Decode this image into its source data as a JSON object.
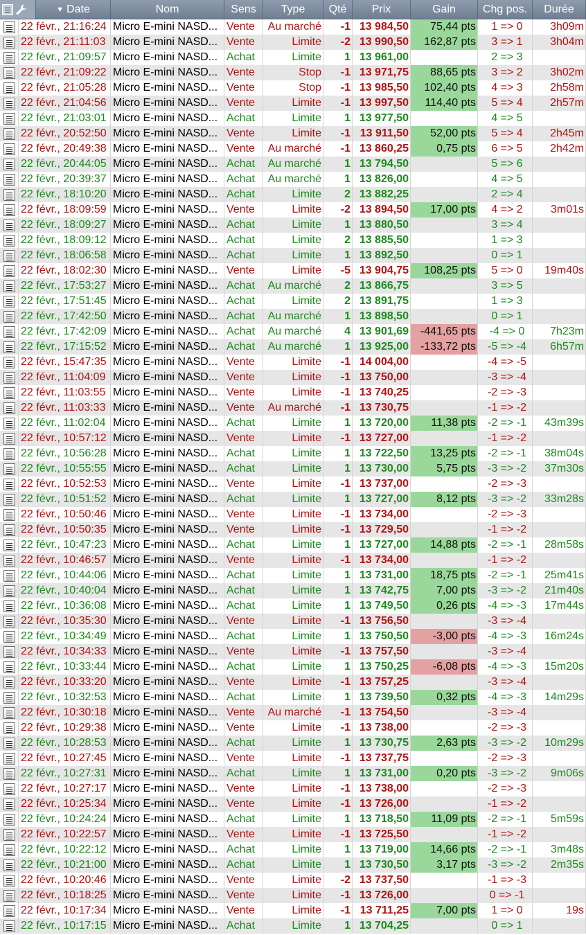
{
  "header": {
    "date": "Date",
    "nom": "Nom",
    "sens": "Sens",
    "type": "Type",
    "qte": "Qté",
    "prix": "Prix",
    "gain": "Gain",
    "chg": "Chg pos.",
    "duree": "Durée"
  },
  "icons": {
    "header_settings": "wrench-icon",
    "header_details": "document-icon",
    "row_details": "document-details-icon",
    "sort": "sort-down-icon"
  },
  "colors": {
    "buy": "#1d8a1d",
    "sell": "#b31212",
    "gain_positive_bg": "#9ad79a",
    "gain_negative_bg": "#e4a1a1",
    "header_bg": "#7d8ca0"
  },
  "rows": [
    {
      "date": "22 févr., 21:16:24",
      "nom": "Micro E-mini NASD...",
      "sens": "Vente",
      "type": "Au marché",
      "qte": "-1",
      "prix": "13 984,50",
      "gain": "75,44 pts",
      "chg": "1 => 0",
      "duree": "3h09m"
    },
    {
      "date": "22 févr., 21:11:03",
      "nom": "Micro E-mini NASD...",
      "sens": "Vente",
      "type": "Limite",
      "qte": "-2",
      "prix": "13 990,50",
      "gain": "162,87 pts",
      "chg": "3 => 1",
      "duree": "3h04m"
    },
    {
      "date": "22 févr., 21:09:57",
      "nom": "Micro E-mini NASD...",
      "sens": "Achat",
      "type": "Limite",
      "qte": "1",
      "prix": "13 961,00",
      "gain": "",
      "chg": "2 => 3",
      "duree": ""
    },
    {
      "date": "22 févr., 21:09:22",
      "nom": "Micro E-mini NASD...",
      "sens": "Vente",
      "type": "Stop",
      "qte": "-1",
      "prix": "13 971,75",
      "gain": "88,65 pts",
      "chg": "3 => 2",
      "duree": "3h02m"
    },
    {
      "date": "22 févr., 21:05:28",
      "nom": "Micro E-mini NASD...",
      "sens": "Vente",
      "type": "Stop",
      "qte": "-1",
      "prix": "13 985,50",
      "gain": "102,40 pts",
      "chg": "4 => 3",
      "duree": "2h58m"
    },
    {
      "date": "22 févr., 21:04:56",
      "nom": "Micro E-mini NASD...",
      "sens": "Vente",
      "type": "Limite",
      "qte": "-1",
      "prix": "13 997,50",
      "gain": "114,40 pts",
      "chg": "5 => 4",
      "duree": "2h57m"
    },
    {
      "date": "22 févr., 21:03:01",
      "nom": "Micro E-mini NASD...",
      "sens": "Achat",
      "type": "Limite",
      "qte": "1",
      "prix": "13 977,50",
      "gain": "",
      "chg": "4 => 5",
      "duree": ""
    },
    {
      "date": "22 févr., 20:52:50",
      "nom": "Micro E-mini NASD...",
      "sens": "Vente",
      "type": "Limite",
      "qte": "-1",
      "prix": "13 911,50",
      "gain": "52,00 pts",
      "chg": "5 => 4",
      "duree": "2h45m"
    },
    {
      "date": "22 févr., 20:49:38",
      "nom": "Micro E-mini NASD...",
      "sens": "Vente",
      "type": "Au marché",
      "qte": "-1",
      "prix": "13 860,25",
      "gain": "0,75 pts",
      "chg": "6 => 5",
      "duree": "2h42m"
    },
    {
      "date": "22 févr., 20:44:05",
      "nom": "Micro E-mini NASD...",
      "sens": "Achat",
      "type": "Au marché",
      "qte": "1",
      "prix": "13 794,50",
      "gain": "",
      "chg": "5 => 6",
      "duree": ""
    },
    {
      "date": "22 févr., 20:39:37",
      "nom": "Micro E-mini NASD...",
      "sens": "Achat",
      "type": "Au marché",
      "qte": "1",
      "prix": "13 826,00",
      "gain": "",
      "chg": "4 => 5",
      "duree": ""
    },
    {
      "date": "22 févr., 18:10:20",
      "nom": "Micro E-mini NASD...",
      "sens": "Achat",
      "type": "Limite",
      "qte": "2",
      "prix": "13 882,25",
      "gain": "",
      "chg": "2 => 4",
      "duree": ""
    },
    {
      "date": "22 févr., 18:09:59",
      "nom": "Micro E-mini NASD...",
      "sens": "Vente",
      "type": "Limite",
      "qte": "-2",
      "prix": "13 894,50",
      "gain": "17,00 pts",
      "chg": "4 => 2",
      "duree": "3m01s"
    },
    {
      "date": "22 févr., 18:09:27",
      "nom": "Micro E-mini NASD...",
      "sens": "Achat",
      "type": "Limite",
      "qte": "1",
      "prix": "13 880,50",
      "gain": "",
      "chg": "3 => 4",
      "duree": ""
    },
    {
      "date": "22 févr., 18:09:12",
      "nom": "Micro E-mini NASD...",
      "sens": "Achat",
      "type": "Limite",
      "qte": "2",
      "prix": "13 885,50",
      "gain": "",
      "chg": "1 => 3",
      "duree": ""
    },
    {
      "date": "22 févr., 18:06:58",
      "nom": "Micro E-mini NASD...",
      "sens": "Achat",
      "type": "Limite",
      "qte": "1",
      "prix": "13 892,50",
      "gain": "",
      "chg": "0 => 1",
      "duree": ""
    },
    {
      "date": "22 févr., 18:02:30",
      "nom": "Micro E-mini NASD...",
      "sens": "Vente",
      "type": "Limite",
      "qte": "-5",
      "prix": "13 904,75",
      "gain": "108,25 pts",
      "chg": "5 => 0",
      "duree": "19m40s"
    },
    {
      "date": "22 févr., 17:53:27",
      "nom": "Micro E-mini NASD...",
      "sens": "Achat",
      "type": "Au marché",
      "qte": "2",
      "prix": "13 866,75",
      "gain": "",
      "chg": "3 => 5",
      "duree": ""
    },
    {
      "date": "22 févr., 17:51:45",
      "nom": "Micro E-mini NASD...",
      "sens": "Achat",
      "type": "Limite",
      "qte": "2",
      "prix": "13 891,75",
      "gain": "",
      "chg": "1 => 3",
      "duree": ""
    },
    {
      "date": "22 févr., 17:42:50",
      "nom": "Micro E-mini NASD...",
      "sens": "Achat",
      "type": "Au marché",
      "qte": "1",
      "prix": "13 898,50",
      "gain": "",
      "chg": "0 => 1",
      "duree": ""
    },
    {
      "date": "22 févr., 17:42:09",
      "nom": "Micro E-mini NASD...",
      "sens": "Achat",
      "type": "Au marché",
      "qte": "4",
      "prix": "13 901,69",
      "gain": "-441,65 pts",
      "chg": "-4 => 0",
      "duree": "7h23m"
    },
    {
      "date": "22 févr., 17:15:52",
      "nom": "Micro E-mini NASD...",
      "sens": "Achat",
      "type": "Au marché",
      "qte": "1",
      "prix": "13 925,00",
      "gain": "-133,72 pts",
      "chg": "-5 => -4",
      "duree": "6h57m"
    },
    {
      "date": "22 févr., 15:47:35",
      "nom": "Micro E-mini NASD...",
      "sens": "Vente",
      "type": "Limite",
      "qte": "-1",
      "prix": "14 004,00",
      "gain": "",
      "chg": "-4 => -5",
      "duree": ""
    },
    {
      "date": "22 févr., 11:04:09",
      "nom": "Micro E-mini NASD...",
      "sens": "Vente",
      "type": "Limite",
      "qte": "-1",
      "prix": "13 750,00",
      "gain": "",
      "chg": "-3 => -4",
      "duree": ""
    },
    {
      "date": "22 févr., 11:03:55",
      "nom": "Micro E-mini NASD...",
      "sens": "Vente",
      "type": "Limite",
      "qte": "-1",
      "prix": "13 740,25",
      "gain": "",
      "chg": "-2 => -3",
      "duree": ""
    },
    {
      "date": "22 févr., 11:03:33",
      "nom": "Micro E-mini NASD...",
      "sens": "Vente",
      "type": "Au marché",
      "qte": "-1",
      "prix": "13 730,75",
      "gain": "",
      "chg": "-1 => -2",
      "duree": ""
    },
    {
      "date": "22 févr., 11:02:04",
      "nom": "Micro E-mini NASD...",
      "sens": "Achat",
      "type": "Limite",
      "qte": "1",
      "prix": "13 720,00",
      "gain": "11,38 pts",
      "chg": "-2 => -1",
      "duree": "43m39s"
    },
    {
      "date": "22 févr., 10:57:12",
      "nom": "Micro E-mini NASD...",
      "sens": "Vente",
      "type": "Limite",
      "qte": "-1",
      "prix": "13 727,00",
      "gain": "",
      "chg": "-1 => -2",
      "duree": ""
    },
    {
      "date": "22 févr., 10:56:28",
      "nom": "Micro E-mini NASD...",
      "sens": "Achat",
      "type": "Limite",
      "qte": "1",
      "prix": "13 722,50",
      "gain": "13,25 pts",
      "chg": "-2 => -1",
      "duree": "38m04s"
    },
    {
      "date": "22 févr., 10:55:55",
      "nom": "Micro E-mini NASD...",
      "sens": "Achat",
      "type": "Limite",
      "qte": "1",
      "prix": "13 730,00",
      "gain": "5,75 pts",
      "chg": "-3 => -2",
      "duree": "37m30s"
    },
    {
      "date": "22 févr., 10:52:53",
      "nom": "Micro E-mini NASD...",
      "sens": "Vente",
      "type": "Limite",
      "qte": "-1",
      "prix": "13 737,00",
      "gain": "",
      "chg": "-2 => -3",
      "duree": ""
    },
    {
      "date": "22 févr., 10:51:52",
      "nom": "Micro E-mini NASD...",
      "sens": "Achat",
      "type": "Limite",
      "qte": "1",
      "prix": "13 727,00",
      "gain": "8,12 pts",
      "chg": "-3 => -2",
      "duree": "33m28s"
    },
    {
      "date": "22 févr., 10:50:46",
      "nom": "Micro E-mini NASD...",
      "sens": "Vente",
      "type": "Limite",
      "qte": "-1",
      "prix": "13 734,00",
      "gain": "",
      "chg": "-2 => -3",
      "duree": ""
    },
    {
      "date": "22 févr., 10:50:35",
      "nom": "Micro E-mini NASD...",
      "sens": "Vente",
      "type": "Limite",
      "qte": "-1",
      "prix": "13 729,50",
      "gain": "",
      "chg": "-1 => -2",
      "duree": ""
    },
    {
      "date": "22 févr., 10:47:23",
      "nom": "Micro E-mini NASD...",
      "sens": "Achat",
      "type": "Limite",
      "qte": "1",
      "prix": "13 727,00",
      "gain": "14,88 pts",
      "chg": "-2 => -1",
      "duree": "28m58s"
    },
    {
      "date": "22 févr., 10:46:57",
      "nom": "Micro E-mini NASD...",
      "sens": "Vente",
      "type": "Limite",
      "qte": "-1",
      "prix": "13 734,00",
      "gain": "",
      "chg": "-1 => -2",
      "duree": ""
    },
    {
      "date": "22 févr., 10:44:06",
      "nom": "Micro E-mini NASD...",
      "sens": "Achat",
      "type": "Limite",
      "qte": "1",
      "prix": "13 731,00",
      "gain": "18,75 pts",
      "chg": "-2 => -1",
      "duree": "25m41s"
    },
    {
      "date": "22 févr., 10:40:04",
      "nom": "Micro E-mini NASD...",
      "sens": "Achat",
      "type": "Limite",
      "qte": "1",
      "prix": "13 742,75",
      "gain": "7,00 pts",
      "chg": "-3 => -2",
      "duree": "21m40s"
    },
    {
      "date": "22 févr., 10:36:08",
      "nom": "Micro E-mini NASD...",
      "sens": "Achat",
      "type": "Limite",
      "qte": "1",
      "prix": "13 749,50",
      "gain": "0,26 pts",
      "chg": "-4 => -3",
      "duree": "17m44s"
    },
    {
      "date": "22 févr., 10:35:30",
      "nom": "Micro E-mini NASD...",
      "sens": "Vente",
      "type": "Limite",
      "qte": "-1",
      "prix": "13 756,50",
      "gain": "",
      "chg": "-3 => -4",
      "duree": ""
    },
    {
      "date": "22 févr., 10:34:49",
      "nom": "Micro E-mini NASD...",
      "sens": "Achat",
      "type": "Limite",
      "qte": "1",
      "prix": "13 750,50",
      "gain": "-3,00 pts",
      "chg": "-4 => -3",
      "duree": "16m24s"
    },
    {
      "date": "22 févr., 10:34:33",
      "nom": "Micro E-mini NASD...",
      "sens": "Vente",
      "type": "Limite",
      "qte": "-1",
      "prix": "13 757,50",
      "gain": "",
      "chg": "-3 => -4",
      "duree": ""
    },
    {
      "date": "22 févr., 10:33:44",
      "nom": "Micro E-mini NASD...",
      "sens": "Achat",
      "type": "Limite",
      "qte": "1",
      "prix": "13 750,25",
      "gain": "-6,08 pts",
      "chg": "-4 => -3",
      "duree": "15m20s"
    },
    {
      "date": "22 févr., 10:33:20",
      "nom": "Micro E-mini NASD...",
      "sens": "Vente",
      "type": "Limite",
      "qte": "-1",
      "prix": "13 757,25",
      "gain": "",
      "chg": "-3 => -4",
      "duree": ""
    },
    {
      "date": "22 févr., 10:32:53",
      "nom": "Micro E-mini NASD...",
      "sens": "Achat",
      "type": "Limite",
      "qte": "1",
      "prix": "13 739,50",
      "gain": "0,32 pts",
      "chg": "-4 => -3",
      "duree": "14m29s"
    },
    {
      "date": "22 févr., 10:30:18",
      "nom": "Micro E-mini NASD...",
      "sens": "Vente",
      "type": "Au marché",
      "qte": "-1",
      "prix": "13 754,50",
      "gain": "",
      "chg": "-3 => -4",
      "duree": ""
    },
    {
      "date": "22 févr., 10:29:38",
      "nom": "Micro E-mini NASD...",
      "sens": "Vente",
      "type": "Limite",
      "qte": "-1",
      "prix": "13 738,00",
      "gain": "",
      "chg": "-2 => -3",
      "duree": ""
    },
    {
      "date": "22 févr., 10:28:53",
      "nom": "Micro E-mini NASD...",
      "sens": "Achat",
      "type": "Limite",
      "qte": "1",
      "prix": "13 730,75",
      "gain": "2,63 pts",
      "chg": "-3 => -2",
      "duree": "10m29s"
    },
    {
      "date": "22 févr., 10:27:45",
      "nom": "Micro E-mini NASD...",
      "sens": "Vente",
      "type": "Limite",
      "qte": "-1",
      "prix": "13 737,75",
      "gain": "",
      "chg": "-2 => -3",
      "duree": ""
    },
    {
      "date": "22 févr., 10:27:31",
      "nom": "Micro E-mini NASD...",
      "sens": "Achat",
      "type": "Limite",
      "qte": "1",
      "prix": "13 731,00",
      "gain": "0,20 pts",
      "chg": "-3 => -2",
      "duree": "9m06s"
    },
    {
      "date": "22 févr., 10:27:17",
      "nom": "Micro E-mini NASD...",
      "sens": "Vente",
      "type": "Limite",
      "qte": "-1",
      "prix": "13 738,00",
      "gain": "",
      "chg": "-2 => -3",
      "duree": ""
    },
    {
      "date": "22 févr., 10:25:34",
      "nom": "Micro E-mini NASD...",
      "sens": "Vente",
      "type": "Limite",
      "qte": "-1",
      "prix": "13 726,00",
      "gain": "",
      "chg": "-1 => -2",
      "duree": ""
    },
    {
      "date": "22 févr., 10:24:24",
      "nom": "Micro E-mini NASD...",
      "sens": "Achat",
      "type": "Limite",
      "qte": "1",
      "prix": "13 718,50",
      "gain": "11,09 pts",
      "chg": "-2 => -1",
      "duree": "5m59s"
    },
    {
      "date": "22 févr., 10:22:57",
      "nom": "Micro E-mini NASD...",
      "sens": "Vente",
      "type": "Limite",
      "qte": "-1",
      "prix": "13 725,50",
      "gain": "",
      "chg": "-1 => -2",
      "duree": ""
    },
    {
      "date": "22 févr., 10:22:12",
      "nom": "Micro E-mini NASD...",
      "sens": "Achat",
      "type": "Limite",
      "qte": "1",
      "prix": "13 719,00",
      "gain": "14,66 pts",
      "chg": "-2 => -1",
      "duree": "3m48s"
    },
    {
      "date": "22 févr., 10:21:00",
      "nom": "Micro E-mini NASD...",
      "sens": "Achat",
      "type": "Limite",
      "qte": "1",
      "prix": "13 730,50",
      "gain": "3,17 pts",
      "chg": "-3 => -2",
      "duree": "2m35s"
    },
    {
      "date": "22 févr., 10:20:46",
      "nom": "Micro E-mini NASD...",
      "sens": "Vente",
      "type": "Limite",
      "qte": "-2",
      "prix": "13 737,50",
      "gain": "",
      "chg": "-1 => -3",
      "duree": ""
    },
    {
      "date": "22 févr., 10:18:25",
      "nom": "Micro E-mini NASD...",
      "sens": "Vente",
      "type": "Limite",
      "qte": "-1",
      "prix": "13 726,00",
      "gain": "",
      "chg": "0 => -1",
      "duree": ""
    },
    {
      "date": "22 févr., 10:17:34",
      "nom": "Micro E-mini NASD...",
      "sens": "Vente",
      "type": "Limite",
      "qte": "-1",
      "prix": "13 711,25",
      "gain": "7,00 pts",
      "chg": "1 => 0",
      "duree": "19s"
    },
    {
      "date": "22 févr., 10:17:15",
      "nom": "Micro E-mini NASD...",
      "sens": "Achat",
      "type": "Limite",
      "qte": "1",
      "prix": "13 704,25",
      "gain": "",
      "chg": "0 => 1",
      "duree": ""
    }
  ]
}
